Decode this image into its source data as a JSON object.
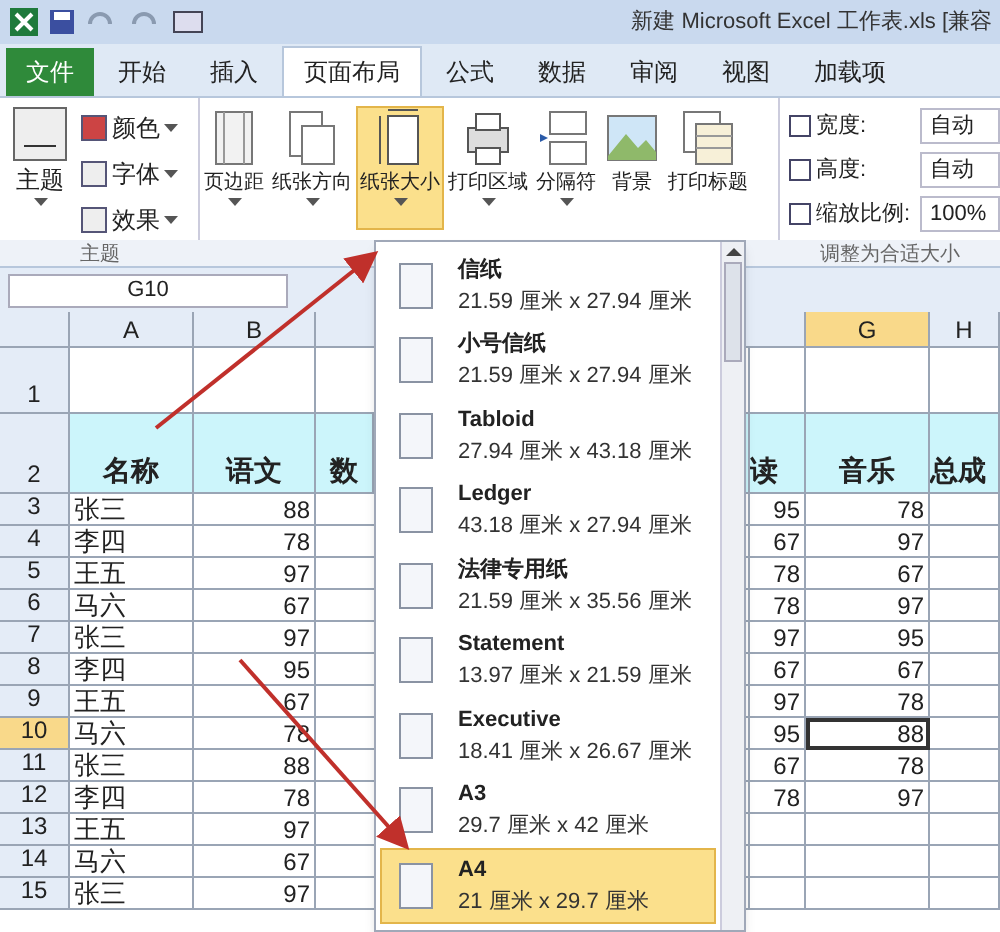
{
  "title_bar": {
    "title": "新建 Microsoft Excel 工作表.xls  [兼容"
  },
  "tabs": [
    {
      "label": "文件",
      "kind": "file",
      "selected": false
    },
    {
      "label": "开始",
      "kind": "tab",
      "selected": false
    },
    {
      "label": "插入",
      "kind": "tab",
      "selected": false
    },
    {
      "label": "页面布局",
      "kind": "tab",
      "selected": true
    },
    {
      "label": "公式",
      "kind": "tab",
      "selected": false
    },
    {
      "label": "数据",
      "kind": "tab",
      "selected": false
    },
    {
      "label": "审阅",
      "kind": "tab",
      "selected": false
    },
    {
      "label": "视图",
      "kind": "tab",
      "selected": false
    },
    {
      "label": "加载项",
      "kind": "tab",
      "selected": false
    }
  ],
  "theme_group": {
    "main": "主题",
    "items": [
      "颜色",
      "字体",
      "效果"
    ],
    "label": "主题"
  },
  "page_buttons": [
    {
      "label": "页边距",
      "selected": false,
      "caret": true
    },
    {
      "label": "纸张方向",
      "selected": false,
      "caret": true
    },
    {
      "label": "纸张大小",
      "selected": true,
      "caret": true
    },
    {
      "label": "打印区域",
      "selected": false,
      "caret": true
    },
    {
      "label": "分隔符",
      "selected": false,
      "caret": true
    },
    {
      "label": "背景",
      "selected": false,
      "caret": false
    },
    {
      "label": "打印标题",
      "selected": false,
      "caret": false
    }
  ],
  "scale_group": {
    "rows": [
      {
        "label": "宽度:",
        "value": "自动"
      },
      {
        "label": "高度:",
        "value": "自动"
      },
      {
        "label": "缩放比例:",
        "value": "100%"
      }
    ],
    "label": "调整为合适大小"
  },
  "name_box": "G10",
  "columns": [
    {
      "label": "A",
      "selected": false
    },
    {
      "label": "B",
      "selected": false
    },
    {
      "label": "G",
      "selected": true
    },
    {
      "label": "H",
      "selected": false
    }
  ],
  "header_row": {
    "number": "2",
    "cells": [
      "名称",
      "语文",
      "数",
      "读",
      "音乐",
      "总成"
    ]
  },
  "rows": [
    {
      "number": "1",
      "selected": false
    },
    {
      "number": "3",
      "selected": false,
      "name": "张三",
      "b": "88",
      "f": "95",
      "g": "78"
    },
    {
      "number": "4",
      "selected": false,
      "name": "李四",
      "b": "78",
      "f": "67",
      "g": "97"
    },
    {
      "number": "5",
      "selected": false,
      "name": "王五",
      "b": "97",
      "f": "78",
      "g": "67"
    },
    {
      "number": "6",
      "selected": false,
      "name": "马六",
      "b": "67",
      "f": "78",
      "g": "97"
    },
    {
      "number": "7",
      "selected": false,
      "name": "张三",
      "b": "97",
      "f": "97",
      "g": "95"
    },
    {
      "number": "8",
      "selected": false,
      "name": "李四",
      "b": "95",
      "f": "67",
      "g": "67"
    },
    {
      "number": "9",
      "selected": false,
      "name": "王五",
      "b": "67",
      "f": "97",
      "g": "78"
    },
    {
      "number": "10",
      "selected": true,
      "name": "马六",
      "b": "78",
      "f": "95",
      "g": "88"
    },
    {
      "number": "11",
      "selected": false,
      "name": "张三",
      "b": "88",
      "f": "67",
      "g": "78"
    },
    {
      "number": "12",
      "selected": false,
      "name": "李四",
      "b": "78",
      "f": "78",
      "g": "97"
    },
    {
      "number": "13",
      "selected": false,
      "name": "王五",
      "b": "97"
    },
    {
      "number": "14",
      "selected": false,
      "name": "马六",
      "b": "67"
    },
    {
      "number": "15",
      "selected": false,
      "name": "张三",
      "b": "97"
    }
  ],
  "paper_menu": [
    {
      "name": "信纸",
      "size": "21.59 厘米 x 27.94 厘米",
      "selected": false
    },
    {
      "name": "小号信纸",
      "size": "21.59 厘米 x 27.94 厘米",
      "selected": false
    },
    {
      "name": "Tabloid",
      "size": "27.94 厘米 x 43.18 厘米",
      "selected": false
    },
    {
      "name": "Ledger",
      "size": "43.18 厘米 x 27.94 厘米",
      "selected": false
    },
    {
      "name": "法律专用纸",
      "size": "21.59 厘米 x 35.56 厘米",
      "selected": false
    },
    {
      "name": "Statement",
      "size": "13.97 厘米 x 21.59 厘米",
      "selected": false
    },
    {
      "name": "Executive",
      "size": "18.41 厘米 x 26.67 厘米",
      "selected": false
    },
    {
      "name": "A3",
      "size": "29.7 厘米 x 42 厘米",
      "selected": false
    },
    {
      "name": "A4",
      "size": "21 厘米 x 29.7 厘米",
      "selected": true
    }
  ]
}
